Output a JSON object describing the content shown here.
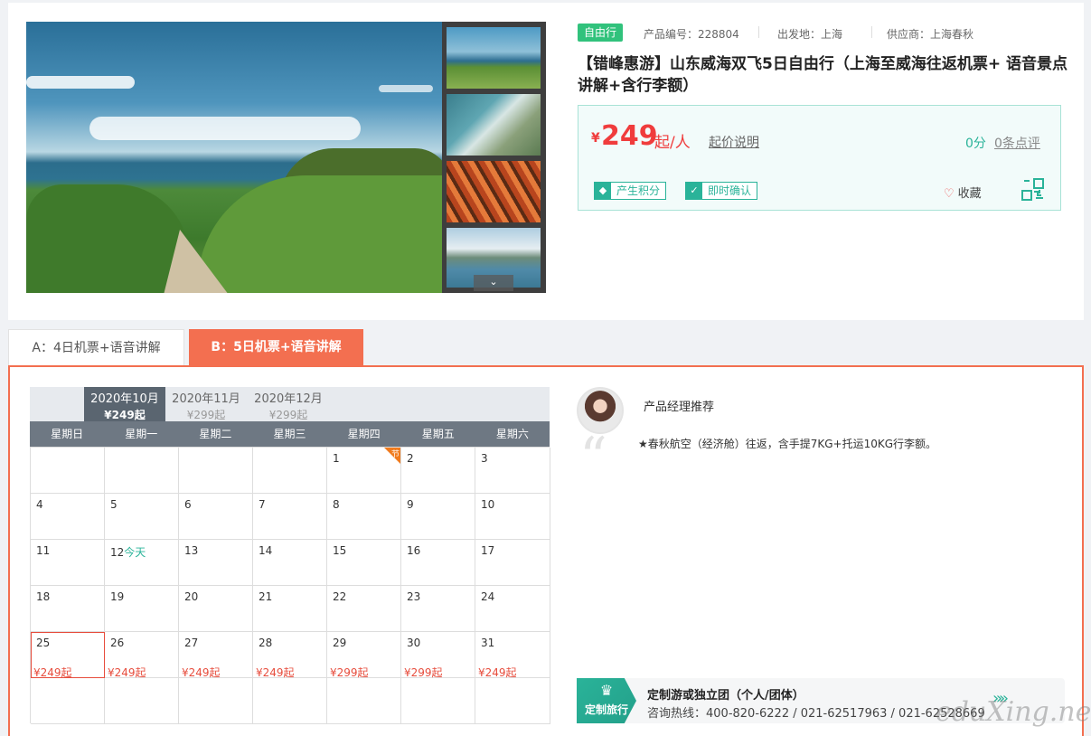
{
  "product": {
    "tag": "自由行",
    "code_label": "产品编号：228804",
    "departure_label": "出发地：上海",
    "supplier_label": "供应商：上海春秋",
    "title": "【错峰惠游】山东威海双飞5日自由行（上海至威海往返机票+ 语音景点讲解+含行李额）",
    "price_currency": "¥",
    "price_value": "249",
    "price_unit": "起/人",
    "price_note": "起价说明",
    "score": "0分",
    "reviews": "0条点评",
    "badge_points": "产生积分",
    "badge_confirm": "即时确认",
    "favorite": "收藏"
  },
  "tabs": [
    {
      "label": "A：4日机票+语音讲解"
    },
    {
      "label": "B：5日机票+语音讲解"
    }
  ],
  "calendar": {
    "months": [
      {
        "label": "2020年10月",
        "price": "¥249起"
      },
      {
        "label": "2020年11月",
        "price": "¥299起"
      },
      {
        "label": "2020年12月",
        "price": "¥299起"
      }
    ],
    "weekdays": [
      "星期日",
      "星期一",
      "星期二",
      "星期三",
      "星期四",
      "星期五",
      "星期六"
    ],
    "holiday_mark": "节",
    "today_label": "今天",
    "days": [
      {
        "d": "1",
        "holiday": true
      },
      {
        "d": "2"
      },
      {
        "d": "3"
      },
      {
        "d": "4"
      },
      {
        "d": "5"
      },
      {
        "d": "6"
      },
      {
        "d": "7"
      },
      {
        "d": "8"
      },
      {
        "d": "9"
      },
      {
        "d": "10"
      },
      {
        "d": "11"
      },
      {
        "d": "12",
        "today": true
      },
      {
        "d": "13"
      },
      {
        "d": "14"
      },
      {
        "d": "15"
      },
      {
        "d": "16"
      },
      {
        "d": "17"
      },
      {
        "d": "18"
      },
      {
        "d": "19"
      },
      {
        "d": "20"
      },
      {
        "d": "21"
      },
      {
        "d": "22"
      },
      {
        "d": "23"
      },
      {
        "d": "24"
      },
      {
        "d": "25",
        "price": "¥249起",
        "selected": true
      },
      {
        "d": "26",
        "price": "¥249起"
      },
      {
        "d": "27",
        "price": "¥249起"
      },
      {
        "d": "28",
        "price": "¥249起"
      },
      {
        "d": "29",
        "price": "¥299起"
      },
      {
        "d": "30",
        "price": "¥299起"
      },
      {
        "d": "31",
        "price": "¥249起"
      }
    ]
  },
  "manager": {
    "title": "产品经理推荐",
    "text": "★春秋航空（经济舱）往返，含手提7KG+托运10KG行李额。"
  },
  "custom": {
    "badge": "定制旅行",
    "title": "定制游或独立团（个人/团体）",
    "phone": "咨询热线：400-820-6222 / 021-62517963 / 021-62528669"
  },
  "watermark": "eduXing.net",
  "colors": {
    "accent": "#f36f50",
    "teal": "#2ab399",
    "price": "#f03c3c"
  }
}
